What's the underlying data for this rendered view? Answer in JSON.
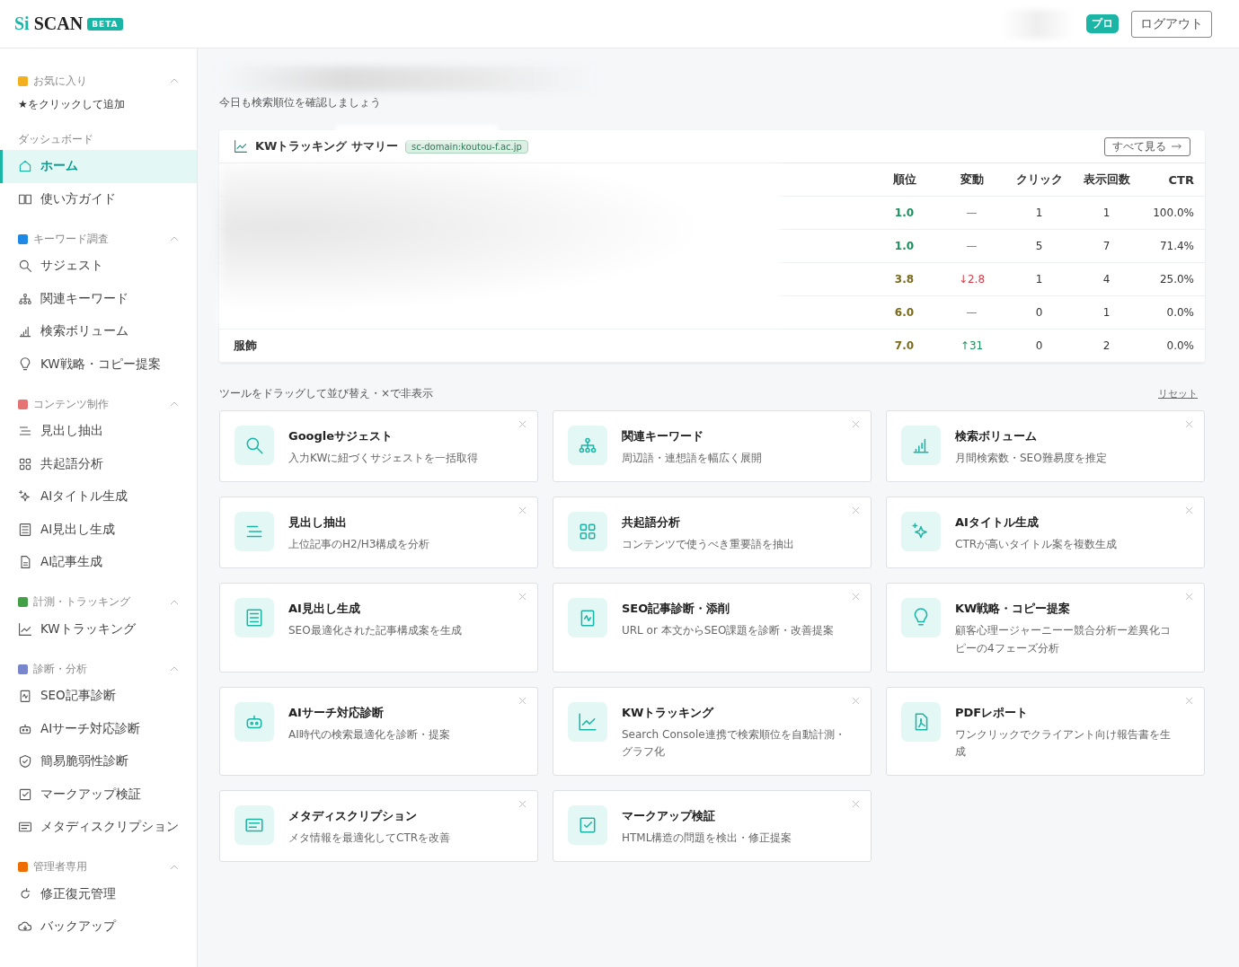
{
  "header": {
    "logo": {
      "prefix": "Si",
      "name": "SCAN",
      "badge": "BETA"
    },
    "plan_badge": "プロ",
    "logout": "ログアウト"
  },
  "sidebar": {
    "sections": [
      {
        "kind": "favorites",
        "title": "お気に入り",
        "expanded": true,
        "hint": "★をクリックして追加"
      },
      {
        "kind": "plain",
        "title": "ダッシュボード",
        "items": [
          {
            "label": "ホーム",
            "selected": true
          },
          {
            "label": "使い方ガイド",
            "selected": false
          }
        ]
      },
      {
        "kind": "group",
        "title": "キーワード調査",
        "expanded": true,
        "items": [
          {
            "label": "サジェスト",
            "selected": false
          },
          {
            "label": "関連キーワード",
            "selected": false
          },
          {
            "label": "検索ボリューム",
            "selected": false
          },
          {
            "label": "KW戦略・コピー提案",
            "selected": false
          }
        ]
      },
      {
        "kind": "group",
        "title": "コンテンツ制作",
        "expanded": true,
        "items": [
          {
            "label": "見出し抽出",
            "selected": false
          },
          {
            "label": "共起語分析",
            "selected": false
          },
          {
            "label": "AIタイトル生成",
            "selected": false
          },
          {
            "label": "AI見出し生成",
            "selected": false
          },
          {
            "label": "AI記事生成",
            "selected": false
          }
        ]
      },
      {
        "kind": "group",
        "title": "計測・トラッキング",
        "expanded": true,
        "items": [
          {
            "label": "KWトラッキング",
            "selected": false
          }
        ]
      },
      {
        "kind": "group",
        "title": "診断・分析",
        "expanded": true,
        "items": [
          {
            "label": "SEO記事診断",
            "selected": false
          },
          {
            "label": "AIサーチ対応診断",
            "selected": false
          },
          {
            "label": "簡易脆弱性診断",
            "selected": false
          },
          {
            "label": "マークアップ検証",
            "selected": false
          },
          {
            "label": "メタディスクリプション",
            "selected": false
          }
        ]
      },
      {
        "kind": "group",
        "title": "管理者専用",
        "expanded": true,
        "items": [
          {
            "label": "修正復元管理",
            "selected": false
          },
          {
            "label": "バックアップ",
            "selected": false
          }
        ]
      }
    ]
  },
  "main": {
    "subtitle": "今日も検索順位を確認しましょう",
    "summary": {
      "title": "KWトラッキング サマリー",
      "domain": "sc-domain:koutou-f.ac.jp",
      "view_all": "すべて見る",
      "columns": [
        "順位",
        "変動",
        "クリック",
        "表示回数",
        "CTR"
      ],
      "rows": [
        {
          "rank": "1.0",
          "top": true,
          "change": "—",
          "falling": false,
          "rising": false,
          "clicks": "1",
          "impressions": "1",
          "ctr": "100.0%"
        },
        {
          "rank": "1.0",
          "top": true,
          "change": "—",
          "falling": false,
          "rising": false,
          "clicks": "5",
          "impressions": "7",
          "ctr": "71.4%"
        },
        {
          "rank": "3.8",
          "top": false,
          "change": "↓2.8",
          "falling": true,
          "rising": false,
          "clicks": "1",
          "impressions": "4",
          "ctr": "25.0%"
        },
        {
          "rank": "6.0",
          "top": false,
          "change": "—",
          "falling": false,
          "rising": false,
          "clicks": "0",
          "impressions": "1",
          "ctr": "0.0%"
        },
        {
          "keyword": "服飾",
          "rank": "7.0",
          "top": false,
          "change": "↑31",
          "falling": false,
          "rising": true,
          "clicks": "0",
          "impressions": "2",
          "ctr": "0.0%"
        }
      ]
    },
    "tools_hint": "ツールをドラッグして並び替え・×で非表示",
    "reset": "リセット",
    "tools": [
      {
        "title": "Googleサジェスト",
        "description": "入力KWに紐づくサジェストを一括取得"
      },
      {
        "title": "関連キーワード",
        "description": "周辺語・連想語を幅広く展開"
      },
      {
        "title": "検索ボリューム",
        "description": "月間検索数・SEO難易度を推定"
      },
      {
        "title": "見出し抽出",
        "description": "上位記事のH2/H3構成を分析"
      },
      {
        "title": "共起語分析",
        "description": "コンテンツで使うべき重要語を抽出"
      },
      {
        "title": "AIタイトル生成",
        "description": "CTRが高いタイトル案を複数生成"
      },
      {
        "title": "AI見出し生成",
        "description": "SEO最適化された記事構成案を生成"
      },
      {
        "title": "SEO記事診断・添削",
        "description": "URL or 本文からSEO課題を診断・改善提案"
      },
      {
        "title": "KW戦略・コピー提案",
        "description": "顧客心理ージャーニーー競合分析ー差異化コピーの4フェーズ分析"
      },
      {
        "title": "AIサーチ対応診断",
        "description": "AI時代の検索最適化を診断・提案"
      },
      {
        "title": "KWトラッキング",
        "description": "Search Console連携で検索順位を自動計測・グラフ化"
      },
      {
        "title": "PDFレポート",
        "description": "ワンクリックでクライアント向け報告書を生成"
      },
      {
        "title": "メタディスクリプション",
        "description": "メタ情報を最適化してCTRを改善"
      },
      {
        "title": "マークアップ検証",
        "description": "HTML構造の問題を検出・修正提案"
      }
    ]
  }
}
